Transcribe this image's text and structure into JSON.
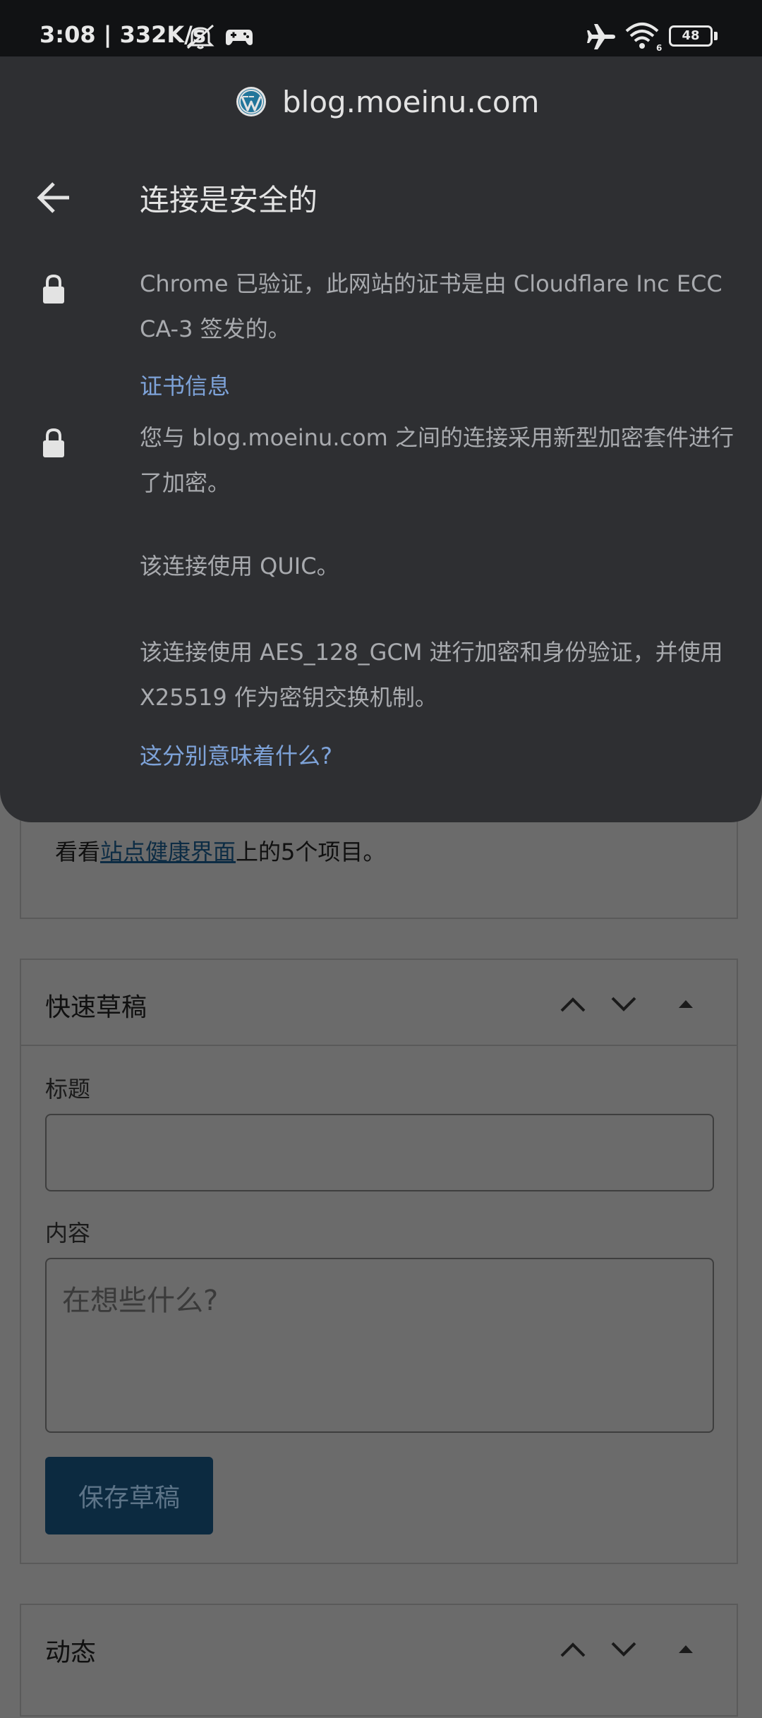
{
  "status_bar": {
    "time_speed": "3:08 | 332K/s",
    "battery": "48",
    "icons": [
      "notifications-off-icon",
      "game-controller-icon",
      "airplane-mode-icon",
      "wifi-icon",
      "battery-icon"
    ]
  },
  "popup": {
    "site": "blog.moeinu.com",
    "title": "连接是安全的",
    "cert_text": "Chrome 已验证，此网站的证书是由 Cloudflare Inc ECC CA-3 签发的。",
    "cert_link": "证书信息",
    "encryption_text": "您与 blog.moeinu.com 之间的连接采用新型加密套件进行了加密。",
    "protocol_text": "该连接使用 QUIC。",
    "cipher_text": "该连接使用 AES_128_GCM 进行加密和身份验证，并使用 X25519 作为密钥交换机制。",
    "help_link": "这分别意味着什么?"
  },
  "dashboard": {
    "health": {
      "prefix": "看看",
      "link": "站点健康界面",
      "suffix": "上的5个项目。"
    },
    "quick_draft": {
      "title": "快速草稿",
      "title_label": "标题",
      "content_label": "内容",
      "content_placeholder": "在想些什么?",
      "save_label": "保存草稿"
    },
    "activity": {
      "title": "动态"
    }
  },
  "colors": {
    "popup_bg": "#2e2f32",
    "link": "#7ea3d9",
    "wp_blue": "#21759b",
    "button_bg": "#0c2a40"
  }
}
